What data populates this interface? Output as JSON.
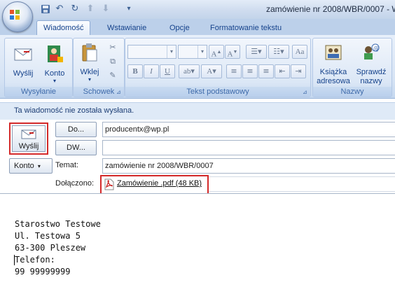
{
  "window": {
    "title": "zamówienie nr 2008/WBR/0007 - W"
  },
  "tabs": [
    {
      "label": "Wiadomość",
      "active": true
    },
    {
      "label": "Wstawianie",
      "active": false
    },
    {
      "label": "Opcje",
      "active": false
    },
    {
      "label": "Formatowanie tekstu",
      "active": false
    }
  ],
  "ribbon": {
    "groups": [
      {
        "label": "Wysyłanie",
        "buttons": [
          "Wyślij",
          "Konto"
        ]
      },
      {
        "label": "Schowek",
        "buttons": [
          "Wklej"
        ]
      },
      {
        "label": "Tekst podstawowy"
      },
      {
        "label": "Nazwy",
        "buttons": [
          "Książka adresowa",
          "Sprawdź nazwy"
        ]
      }
    ],
    "paste_label": "Wklej",
    "send_label": "Wyślij",
    "account_label": "Konto",
    "addressbook_line1": "Książka",
    "addressbook_line2": "adresowa",
    "checknames_line1": "Sprawdź",
    "checknames_line2": "nazwy"
  },
  "infobar": {
    "text": "Ta wiadomość nie została wysłana."
  },
  "header": {
    "send_label": "Wyślij",
    "to_button": "Do...",
    "cc_button": "DW...",
    "account_button": "Konto",
    "to_value": "producentx@wp.pl",
    "cc_value": "",
    "subject_label": "Temat:",
    "subject_value": "zamówienie nr 2008/WBR/0007",
    "attached_label": "Dołączono:",
    "attachment": "Zamówienie .pdf (48 KB)"
  },
  "body": {
    "lines": [
      "Starostwo Testowe",
      "Ul. Testowa 5",
      "63-300 Pleszew",
      "Telefon:",
      "99 99999999"
    ]
  },
  "colors": {
    "accent": "#15428b",
    "highlight_border": "#d42a2a",
    "pdf_red": "#c8201f"
  }
}
